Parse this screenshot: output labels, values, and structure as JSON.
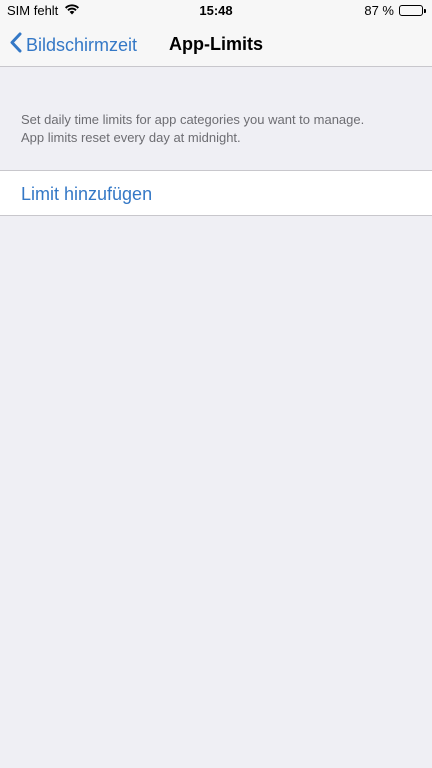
{
  "status_bar": {
    "carrier": "SIM fehlt",
    "time": "15:48",
    "battery_percent": "87 %",
    "battery_level": 0.87,
    "wifi_icon": "wifi-icon",
    "battery_icon": "battery-icon"
  },
  "nav": {
    "back_label": "Bildschirmzeit",
    "back_icon": "chevron-left-icon",
    "title": "App-Limits",
    "accent_color": "#3478c6"
  },
  "description": {
    "line1": "Set daily time limits for app categories you want to manage.",
    "line2": "App limits reset every day at midnight."
  },
  "actions": {
    "add_limit_label": "Limit hinzufügen"
  }
}
